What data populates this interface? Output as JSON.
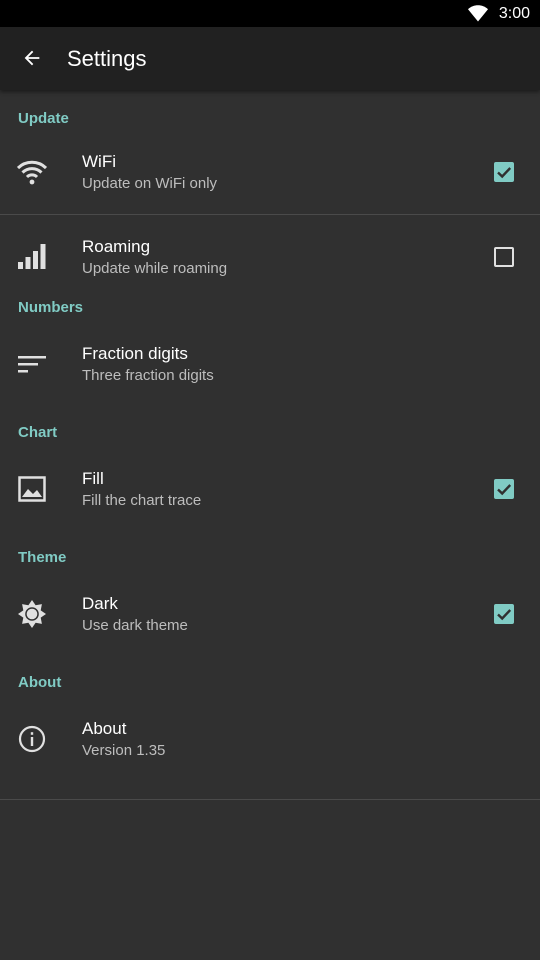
{
  "status_bar": {
    "time": "3:00",
    "icons": [
      "wifi-icon",
      "battery-icon"
    ]
  },
  "app_bar": {
    "title": "Settings",
    "back_icon": "arrow-back-icon"
  },
  "colors": {
    "accent": "#80cbc4",
    "background": "#303030",
    "app_bar": "#212121",
    "status_bar": "#000000"
  },
  "sections": {
    "update": {
      "header": "Update",
      "wifi": {
        "title": "WiFi",
        "summary": "Update on WiFi only",
        "icon": "wifi-icon",
        "checked": true
      },
      "roaming": {
        "title": "Roaming",
        "summary": "Update while roaming",
        "icon": "signal-bars-icon",
        "checked": false
      }
    },
    "numbers": {
      "header": "Numbers",
      "fraction": {
        "title": "Fraction digits",
        "summary": "Three fraction digits",
        "icon": "sort-lines-icon"
      }
    },
    "chart": {
      "header": "Chart",
      "fill": {
        "title": "Fill",
        "summary": "Fill the chart trace",
        "icon": "image-icon",
        "checked": true
      }
    },
    "theme": {
      "header": "Theme",
      "dark": {
        "title": "Dark",
        "summary": "Use dark theme",
        "icon": "brightness-icon",
        "checked": true
      }
    },
    "about": {
      "header": "About",
      "about": {
        "title": "About",
        "summary": "Version 1.35",
        "icon": "info-icon"
      }
    }
  }
}
